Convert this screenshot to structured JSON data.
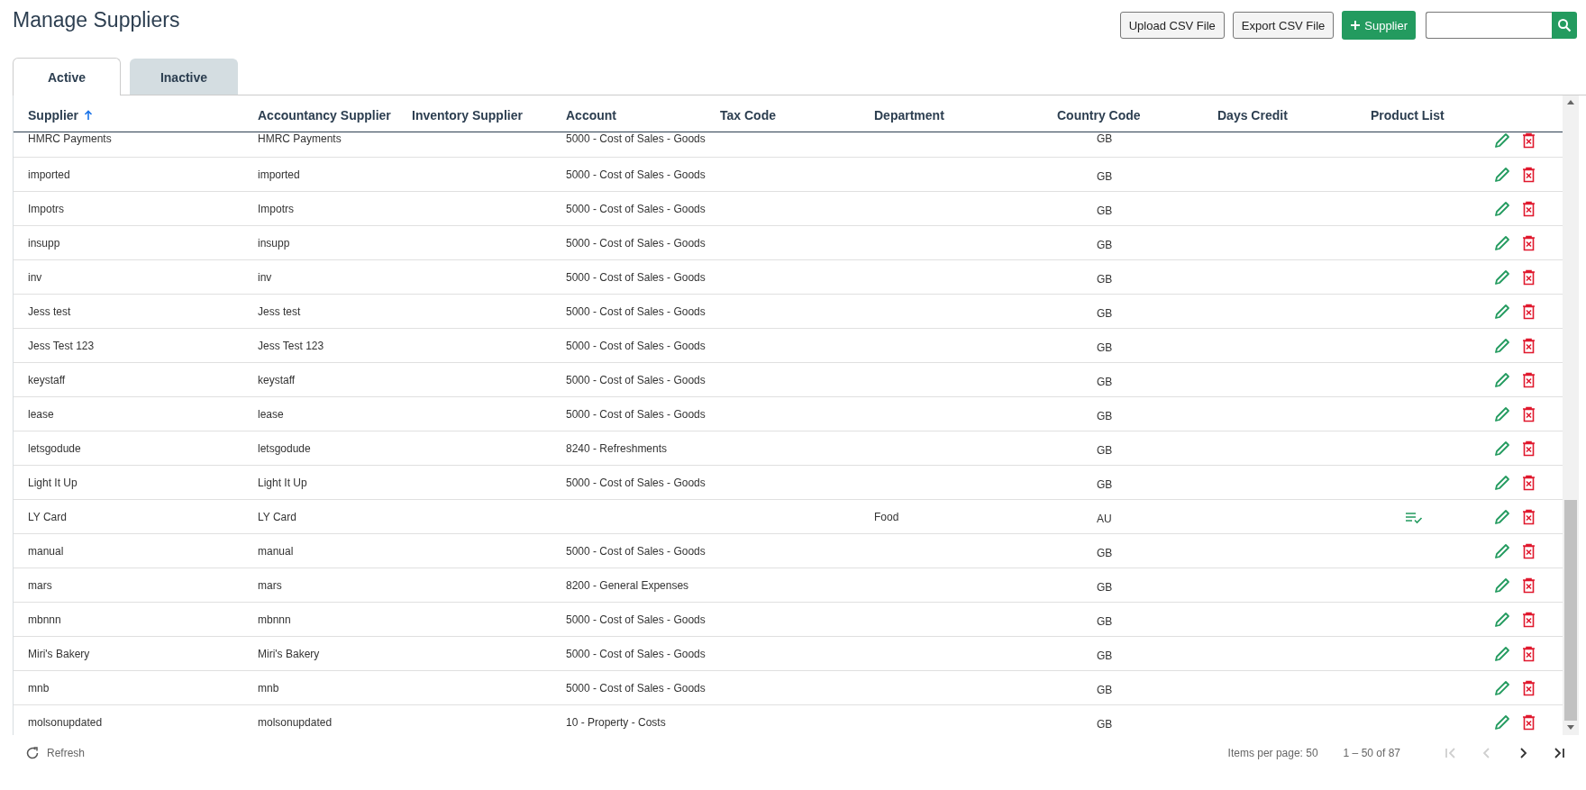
{
  "page": {
    "title": "Manage Suppliers"
  },
  "toolbar": {
    "buttons": [
      {
        "label": "Upload CSV File",
        "kind": "outline"
      },
      {
        "label": "Export CSV File",
        "kind": "outline"
      },
      {
        "label": "Supplier",
        "kind": "add"
      }
    ]
  },
  "tabs": [
    {
      "label": "Active",
      "selected": true
    },
    {
      "label": "Inactive",
      "selected": false
    }
  ],
  "table": {
    "columns": [
      {
        "label": "Supplier",
        "sorted": true
      },
      {
        "label": "Accountancy Supplier",
        "sorted": false
      },
      {
        "label": "Inventory Supplier",
        "sorted": false
      },
      {
        "label": "Account",
        "sorted": false
      },
      {
        "label": "Tax Code",
        "sorted": false
      },
      {
        "label": "Department",
        "sorted": false
      },
      {
        "label": "Country Code",
        "sorted": false
      },
      {
        "label": "Days Credit",
        "sorted": false
      },
      {
        "label": "Product List",
        "sorted": false
      }
    ],
    "rows": [
      {
        "supplier": "HMRC Payments",
        "accountancy_supplier": "HMRC Payments",
        "account": "5000 - Cost of Sales - Goods",
        "department": "",
        "country_code": "GB",
        "product_list": false
      },
      {
        "supplier": "imported",
        "accountancy_supplier": "imported",
        "account": "5000 - Cost of Sales - Goods",
        "department": "",
        "country_code": "GB",
        "product_list": false
      },
      {
        "supplier": "Impotrs",
        "accountancy_supplier": "Impotrs",
        "account": "5000 - Cost of Sales - Goods",
        "department": "",
        "country_code": "GB",
        "product_list": false
      },
      {
        "supplier": "insupp",
        "accountancy_supplier": "insupp",
        "account": "5000 - Cost of Sales - Goods",
        "department": "",
        "country_code": "GB",
        "product_list": false
      },
      {
        "supplier": "inv",
        "accountancy_supplier": "inv",
        "account": "5000 - Cost of Sales - Goods",
        "department": "",
        "country_code": "GB",
        "product_list": false
      },
      {
        "supplier": "Jess test",
        "accountancy_supplier": "Jess test",
        "account": "5000 - Cost of Sales - Goods",
        "department": "",
        "country_code": "GB",
        "product_list": false
      },
      {
        "supplier": "Jess Test 123",
        "accountancy_supplier": "Jess Test 123",
        "account": "5000 - Cost of Sales - Goods",
        "department": "",
        "country_code": "GB",
        "product_list": false
      },
      {
        "supplier": "keystaff",
        "accountancy_supplier": "keystaff",
        "account": "5000 - Cost of Sales - Goods",
        "department": "",
        "country_code": "GB",
        "product_list": false
      },
      {
        "supplier": "lease",
        "accountancy_supplier": "lease",
        "account": "5000 - Cost of Sales - Goods",
        "department": "",
        "country_code": "GB",
        "product_list": false
      },
      {
        "supplier": "letsgodude",
        "accountancy_supplier": "letsgodude",
        "account": "8240 - Refreshments",
        "department": "",
        "country_code": "GB",
        "product_list": false
      },
      {
        "supplier": "Light It Up",
        "accountancy_supplier": "Light It Up",
        "account": "5000 - Cost of Sales - Goods",
        "department": "",
        "country_code": "GB",
        "product_list": false
      },
      {
        "supplier": "LY Card",
        "accountancy_supplier": "LY Card",
        "account": "",
        "department": "Food",
        "country_code": "AU",
        "product_list": true
      },
      {
        "supplier": "manual",
        "accountancy_supplier": "manual",
        "account": "5000 - Cost of Sales - Goods",
        "department": "",
        "country_code": "GB",
        "product_list": false
      },
      {
        "supplier": "mars",
        "accountancy_supplier": "mars",
        "account": "8200 - General Expenses",
        "department": "",
        "country_code": "GB",
        "product_list": false
      },
      {
        "supplier": "mbnnn",
        "accountancy_supplier": "mbnnn",
        "account": "5000 - Cost of Sales - Goods",
        "department": "",
        "country_code": "GB",
        "product_list": false
      },
      {
        "supplier": "Miri's Bakery",
        "accountancy_supplier": "Miri's Bakery",
        "account": "5000 - Cost of Sales - Goods",
        "department": "",
        "country_code": "GB",
        "product_list": false
      },
      {
        "supplier": "mnb",
        "accountancy_supplier": "mnb",
        "account": "5000 - Cost of Sales - Goods",
        "department": "",
        "country_code": "GB",
        "product_list": false
      },
      {
        "supplier": "molsonupdated",
        "accountancy_supplier": "molsonupdated",
        "account": "10 - Property - Costs",
        "department": "",
        "country_code": "GB",
        "product_list": false
      }
    ]
  },
  "footer": {
    "refresh": "Refresh",
    "items_per_page": "Items per page: 50",
    "range": "1 – 50 of 87",
    "pager": [
      {
        "kind": "first",
        "disabled": true
      },
      {
        "kind": "prev",
        "disabled": true
      },
      {
        "kind": "next",
        "disabled": false
      },
      {
        "kind": "last",
        "disabled": false
      }
    ]
  }
}
